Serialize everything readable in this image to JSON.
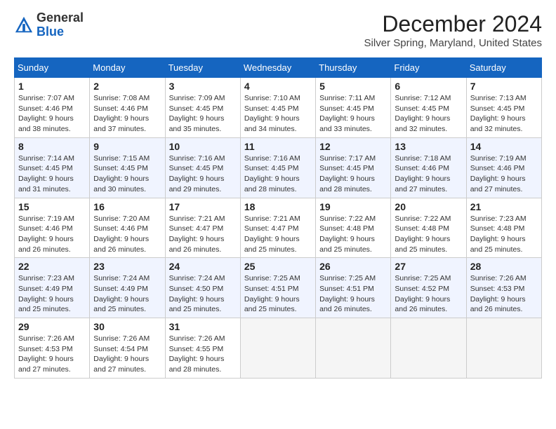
{
  "header": {
    "logo_line1": "General",
    "logo_line2": "Blue",
    "title": "December 2024",
    "subtitle": "Silver Spring, Maryland, United States"
  },
  "columns": [
    "Sunday",
    "Monday",
    "Tuesday",
    "Wednesday",
    "Thursday",
    "Friday",
    "Saturday"
  ],
  "weeks": [
    [
      {
        "day": "1",
        "sunrise": "7:07 AM",
        "sunset": "4:46 PM",
        "daylight": "9 hours and 38 minutes."
      },
      {
        "day": "2",
        "sunrise": "7:08 AM",
        "sunset": "4:46 PM",
        "daylight": "9 hours and 37 minutes."
      },
      {
        "day": "3",
        "sunrise": "7:09 AM",
        "sunset": "4:45 PM",
        "daylight": "9 hours and 35 minutes."
      },
      {
        "day": "4",
        "sunrise": "7:10 AM",
        "sunset": "4:45 PM",
        "daylight": "9 hours and 34 minutes."
      },
      {
        "day": "5",
        "sunrise": "7:11 AM",
        "sunset": "4:45 PM",
        "daylight": "9 hours and 33 minutes."
      },
      {
        "day": "6",
        "sunrise": "7:12 AM",
        "sunset": "4:45 PM",
        "daylight": "9 hours and 32 minutes."
      },
      {
        "day": "7",
        "sunrise": "7:13 AM",
        "sunset": "4:45 PM",
        "daylight": "9 hours and 32 minutes."
      }
    ],
    [
      {
        "day": "8",
        "sunrise": "7:14 AM",
        "sunset": "4:45 PM",
        "daylight": "9 hours and 31 minutes."
      },
      {
        "day": "9",
        "sunrise": "7:15 AM",
        "sunset": "4:45 PM",
        "daylight": "9 hours and 30 minutes."
      },
      {
        "day": "10",
        "sunrise": "7:16 AM",
        "sunset": "4:45 PM",
        "daylight": "9 hours and 29 minutes."
      },
      {
        "day": "11",
        "sunrise": "7:16 AM",
        "sunset": "4:45 PM",
        "daylight": "9 hours and 28 minutes."
      },
      {
        "day": "12",
        "sunrise": "7:17 AM",
        "sunset": "4:45 PM",
        "daylight": "9 hours and 28 minutes."
      },
      {
        "day": "13",
        "sunrise": "7:18 AM",
        "sunset": "4:46 PM",
        "daylight": "9 hours and 27 minutes."
      },
      {
        "day": "14",
        "sunrise": "7:19 AM",
        "sunset": "4:46 PM",
        "daylight": "9 hours and 27 minutes."
      }
    ],
    [
      {
        "day": "15",
        "sunrise": "7:19 AM",
        "sunset": "4:46 PM",
        "daylight": "9 hours and 26 minutes."
      },
      {
        "day": "16",
        "sunrise": "7:20 AM",
        "sunset": "4:46 PM",
        "daylight": "9 hours and 26 minutes."
      },
      {
        "day": "17",
        "sunrise": "7:21 AM",
        "sunset": "4:47 PM",
        "daylight": "9 hours and 26 minutes."
      },
      {
        "day": "18",
        "sunrise": "7:21 AM",
        "sunset": "4:47 PM",
        "daylight": "9 hours and 25 minutes."
      },
      {
        "day": "19",
        "sunrise": "7:22 AM",
        "sunset": "4:48 PM",
        "daylight": "9 hours and 25 minutes."
      },
      {
        "day": "20",
        "sunrise": "7:22 AM",
        "sunset": "4:48 PM",
        "daylight": "9 hours and 25 minutes."
      },
      {
        "day": "21",
        "sunrise": "7:23 AM",
        "sunset": "4:48 PM",
        "daylight": "9 hours and 25 minutes."
      }
    ],
    [
      {
        "day": "22",
        "sunrise": "7:23 AM",
        "sunset": "4:49 PM",
        "daylight": "9 hours and 25 minutes."
      },
      {
        "day": "23",
        "sunrise": "7:24 AM",
        "sunset": "4:49 PM",
        "daylight": "9 hours and 25 minutes."
      },
      {
        "day": "24",
        "sunrise": "7:24 AM",
        "sunset": "4:50 PM",
        "daylight": "9 hours and 25 minutes."
      },
      {
        "day": "25",
        "sunrise": "7:25 AM",
        "sunset": "4:51 PM",
        "daylight": "9 hours and 25 minutes."
      },
      {
        "day": "26",
        "sunrise": "7:25 AM",
        "sunset": "4:51 PM",
        "daylight": "9 hours and 26 minutes."
      },
      {
        "day": "27",
        "sunrise": "7:25 AM",
        "sunset": "4:52 PM",
        "daylight": "9 hours and 26 minutes."
      },
      {
        "day": "28",
        "sunrise": "7:26 AM",
        "sunset": "4:53 PM",
        "daylight": "9 hours and 26 minutes."
      }
    ],
    [
      {
        "day": "29",
        "sunrise": "7:26 AM",
        "sunset": "4:53 PM",
        "daylight": "9 hours and 27 minutes."
      },
      {
        "day": "30",
        "sunrise": "7:26 AM",
        "sunset": "4:54 PM",
        "daylight": "9 hours and 27 minutes."
      },
      {
        "day": "31",
        "sunrise": "7:26 AM",
        "sunset": "4:55 PM",
        "daylight": "9 hours and 28 minutes."
      },
      null,
      null,
      null,
      null
    ]
  ]
}
